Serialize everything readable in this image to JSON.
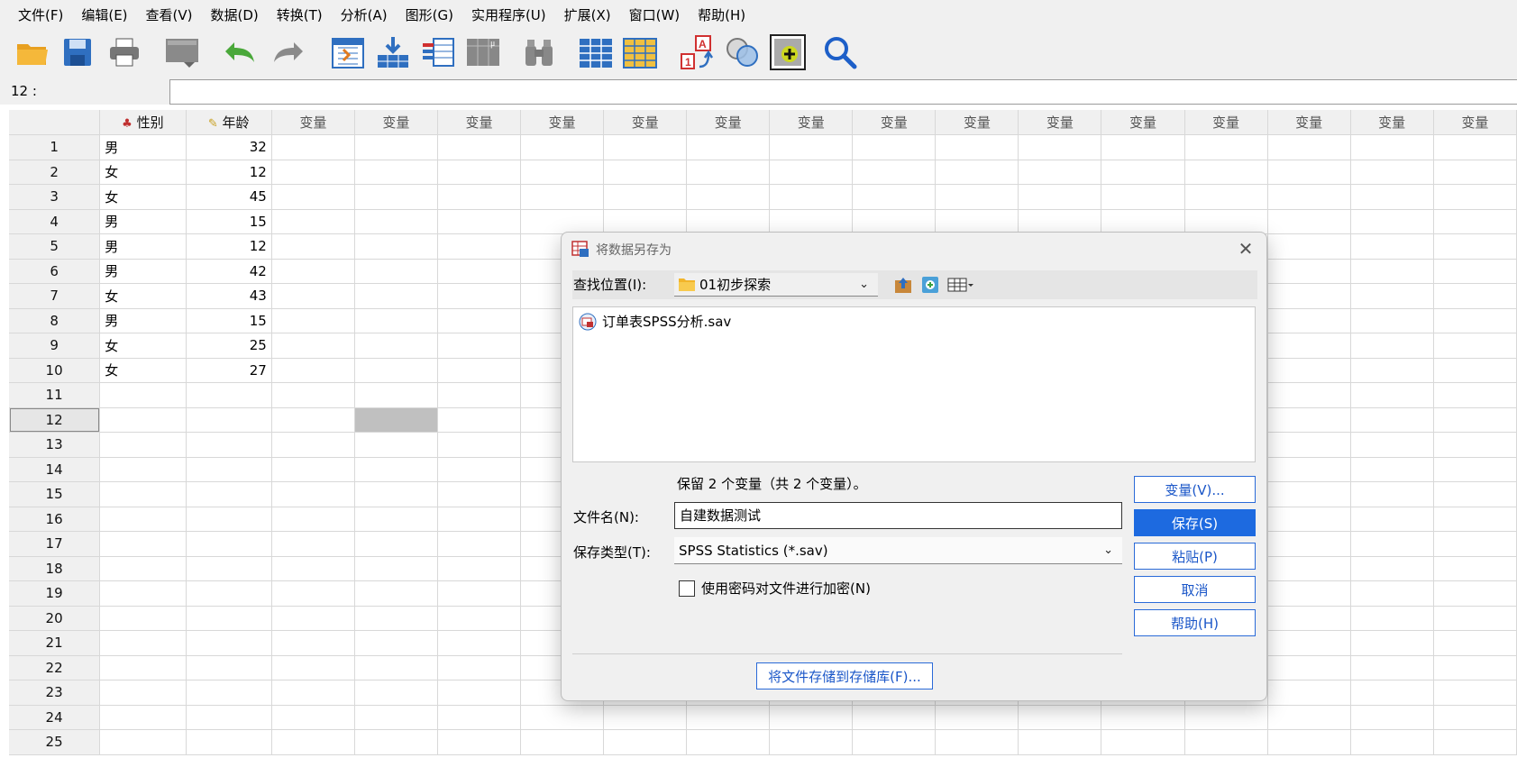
{
  "menubar": [
    "文件(F)",
    "编辑(E)",
    "查看(V)",
    "数据(D)",
    "转换(T)",
    "分析(A)",
    "图形(G)",
    "实用程序(U)",
    "扩展(X)",
    "窗口(W)",
    "帮助(H)"
  ],
  "toolbar_icons": [
    "open-icon",
    "save-icon",
    "print-icon",
    "recall-dialog-icon",
    "undo-icon",
    "redo-icon",
    "goto-case-icon",
    "goto-variable-icon",
    "variables-icon",
    "run-descriptives-icon",
    "find-icon",
    "insert-cases-icon",
    "insert-variable-icon",
    "split-file-icon",
    "select-cases-icon",
    "value-labels-icon",
    "search-icon"
  ],
  "cell_editor": {
    "ref": "12 :",
    "value": ""
  },
  "grid": {
    "columns": [
      "性别",
      "年龄",
      "变量",
      "变量",
      "变量",
      "变量",
      "变量",
      "变量",
      "变量",
      "变量",
      "变量",
      "变量",
      "变量",
      "变量",
      "变量",
      "变量",
      "变量"
    ],
    "rows": [
      [
        "男",
        "32"
      ],
      [
        "女",
        "12"
      ],
      [
        "女",
        "45"
      ],
      [
        "男",
        "15"
      ],
      [
        "男",
        "12"
      ],
      [
        "男",
        "42"
      ],
      [
        "女",
        "43"
      ],
      [
        "男",
        "15"
      ],
      [
        "女",
        "25"
      ],
      [
        "女",
        "27"
      ],
      [
        "",
        ""
      ],
      [
        "",
        ""
      ],
      [
        "",
        ""
      ],
      [
        "",
        ""
      ],
      [
        "",
        ""
      ],
      [
        "",
        ""
      ],
      [
        "",
        ""
      ],
      [
        "",
        ""
      ],
      [
        "",
        ""
      ],
      [
        "",
        ""
      ],
      [
        "",
        ""
      ],
      [
        "",
        ""
      ],
      [
        "",
        ""
      ],
      [
        "",
        ""
      ],
      [
        "",
        ""
      ]
    ],
    "selected_row": 12,
    "selected_col": 4
  },
  "dialog": {
    "title": "将数据另存为",
    "lookin_label": "查找位置(I):",
    "lookin_value": "01初步探索",
    "files": [
      "订单表SPSS分析.sav"
    ],
    "keep_info": "保留 2 个变量（共 2 个变量）。",
    "filename_label": "文件名(N):",
    "filename_value": "自建数据测试",
    "filetype_label": "保存类型(T):",
    "filetype_value": "SPSS Statistics (*.sav)",
    "encrypt_label": "使用密码对文件进行加密(N)",
    "encrypt_checked": false,
    "repo_button": "将文件存储到存储库(F)...",
    "buttons": {
      "variables": "变量(V)...",
      "save": "保存(S)",
      "paste": "粘贴(P)",
      "cancel": "取消",
      "help": "帮助(H)"
    }
  },
  "colors": {
    "accent": "#1d6ae0",
    "toolbar_bg": "#f0f0f0",
    "selected_cell": "#c0c0c0"
  }
}
